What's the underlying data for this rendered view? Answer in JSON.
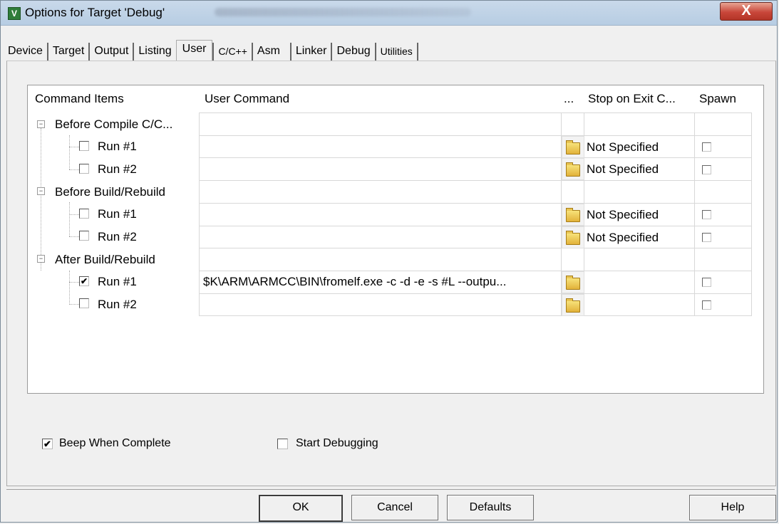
{
  "window": {
    "title": "Options for Target 'Debug'",
    "close_label": "X",
    "icon_label": "V"
  },
  "tabs": [
    {
      "label": "Device"
    },
    {
      "label": "Target"
    },
    {
      "label": "Output"
    },
    {
      "label": "Listing"
    },
    {
      "label": "User",
      "active": true
    },
    {
      "label": "C/C++"
    },
    {
      "label": "Asm"
    },
    {
      "label": "Linker"
    },
    {
      "label": "Debug"
    },
    {
      "label": "Utilities"
    }
  ],
  "table": {
    "headers": {
      "items": "Command Items",
      "command": "User Command",
      "browse": "...",
      "stop": "Stop on Exit C...",
      "spawn": "Spawn"
    },
    "groups": [
      {
        "label": "Before Compile C/C...",
        "rows": [
          {
            "label": "Run #1",
            "checked": false,
            "command": "",
            "stop": "Not Specified"
          },
          {
            "label": "Run #2",
            "checked": false,
            "command": "",
            "stop": "Not Specified"
          }
        ]
      },
      {
        "label": "Before Build/Rebuild",
        "rows": [
          {
            "label": "Run #1",
            "checked": false,
            "command": "",
            "stop": "Not Specified"
          },
          {
            "label": "Run #2",
            "checked": false,
            "command": "",
            "stop": "Not Specified"
          }
        ]
      },
      {
        "label": "After Build/Rebuild",
        "rows": [
          {
            "label": "Run #1",
            "checked": true,
            "command": "$K\\ARM\\ARMCC\\BIN\\fromelf.exe -c -d -e -s #L --outpu...",
            "stop": ""
          },
          {
            "label": "Run #2",
            "checked": false,
            "command": "",
            "stop": ""
          }
        ]
      }
    ],
    "checkmark": "✔",
    "expander": "−"
  },
  "options": {
    "beep": {
      "label": "Beep When Complete",
      "checked": true
    },
    "debug": {
      "label": "Start Debugging",
      "checked": false
    }
  },
  "buttons": {
    "ok": "OK",
    "cancel": "Cancel",
    "defaults": "Defaults",
    "help": "Help"
  }
}
